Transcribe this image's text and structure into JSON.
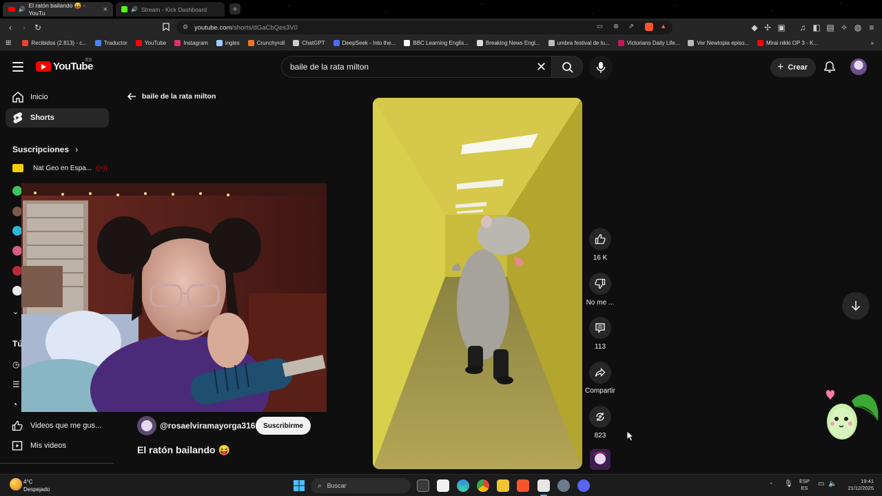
{
  "browser": {
    "tabs": [
      {
        "title": "El ratón bailando 😝 - YouTu",
        "active": true
      },
      {
        "title": "Stream - Kick Dashboard",
        "active": false
      }
    ],
    "url_host": "youtube.com",
    "url_path": "/shorts/dGaCbQes3V0",
    "bookmarks": [
      {
        "label": "Recibidos (2.813) - c...",
        "icon": "gmail-icon",
        "color": "#ea4335"
      },
      {
        "label": "Traductor",
        "icon": "translate-icon",
        "color": "#4285f4"
      },
      {
        "label": "YouTube",
        "icon": "youtube-icon",
        "color": "#ff0000"
      },
      {
        "label": "Instagram",
        "icon": "instagram-icon",
        "color": "#e1306c"
      },
      {
        "label": "ingles",
        "icon": "cloud-icon",
        "color": "#9ecbff"
      },
      {
        "label": "Crunchyroll",
        "icon": "crunchyroll-icon",
        "color": "#f47521"
      },
      {
        "label": "ChatGPT",
        "icon": "chatgpt-icon",
        "color": "#cccccc"
      },
      {
        "label": "DeepSeek - Into the...",
        "icon": "deepseek-icon",
        "color": "#4d6bfe"
      },
      {
        "label": "BBC Learning Englis...",
        "icon": "bbc-icon",
        "color": "#ffffff"
      },
      {
        "label": "Breaking News Engl...",
        "icon": "b-icon",
        "color": "#dddddd"
      },
      {
        "label": "umbra festival de lu...",
        "icon": "globe-icon",
        "color": "#bbbbbb"
      },
      {
        "label": "Victorians Daily Life...",
        "icon": "victorians-icon",
        "color": "#c2185b"
      },
      {
        "label": "Ver Newtopia episo...",
        "icon": "search-g-icon",
        "color": "#bbbbbb"
      },
      {
        "label": "Mirai nikki OP 3 - K...",
        "icon": "youtube-icon",
        "color": "#ff0000"
      }
    ]
  },
  "youtube": {
    "logo": "YouTube",
    "region": "ES",
    "search_query": "baile de la rata milton",
    "create_label": "Crear",
    "back_label": "baile de la rata milton",
    "nav": [
      {
        "label": "Inicio",
        "icon": "home-icon",
        "active": false
      },
      {
        "label": "Shorts",
        "icon": "shorts-icon",
        "active": true
      }
    ],
    "subscriptions_title": "Suscripciones",
    "subscription_first": "Nat Geo en Espa...",
    "bottom_nav": [
      {
        "label": "Videos que me gus...",
        "icon": "like-icon"
      },
      {
        "label": "Mis videos",
        "icon": "my-videos-icon"
      }
    ],
    "partial_section": "Tú",
    "short": {
      "channel": "@rosaelviramayorga3161",
      "subscribe_label": "Suscribirme",
      "title": "El ratón bailando 😝"
    },
    "actions": {
      "likes": "16 K",
      "dislike": "No me ...",
      "comments": "113",
      "share": "Compartir",
      "remix": "823"
    }
  },
  "taskbar": {
    "weather_temp": "4°C",
    "weather_desc": "Despejado",
    "search_placeholder": "Buscar",
    "lang_top": "ESP",
    "lang_bottom": "ES",
    "time": "19:41",
    "date": "21/12/2025"
  }
}
